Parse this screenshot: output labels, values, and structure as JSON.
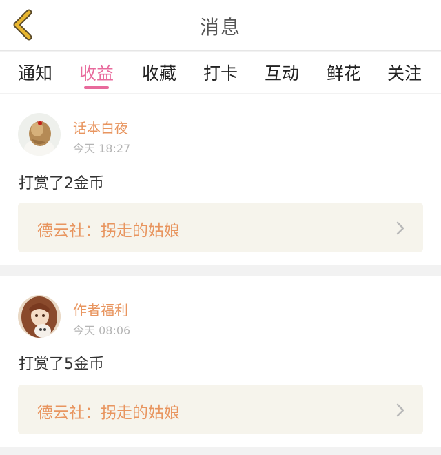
{
  "header": {
    "title": "消息",
    "back_icon": "chevron-left-icon"
  },
  "tabs": [
    {
      "label": "通知",
      "active": false
    },
    {
      "label": "收益",
      "active": true
    },
    {
      "label": "收藏",
      "active": false
    },
    {
      "label": "打卡",
      "active": false
    },
    {
      "label": "互动",
      "active": false
    },
    {
      "label": "鲜花",
      "active": false
    },
    {
      "label": "关注",
      "active": false
    }
  ],
  "colors": {
    "accent": "#e86a9c",
    "username": "#e8955f",
    "back_arrow": "#e8b630",
    "link_bg": "#f6f4ec"
  },
  "messages": [
    {
      "username": "话本白夜",
      "time": "今天 18:27",
      "text": "打赏了2金币",
      "link": "德云社：拐走的姑娘"
    },
    {
      "username": "作者福利",
      "time": "今天 08:06",
      "text": "打赏了5金币",
      "link": "德云社：拐走的姑娘"
    }
  ]
}
